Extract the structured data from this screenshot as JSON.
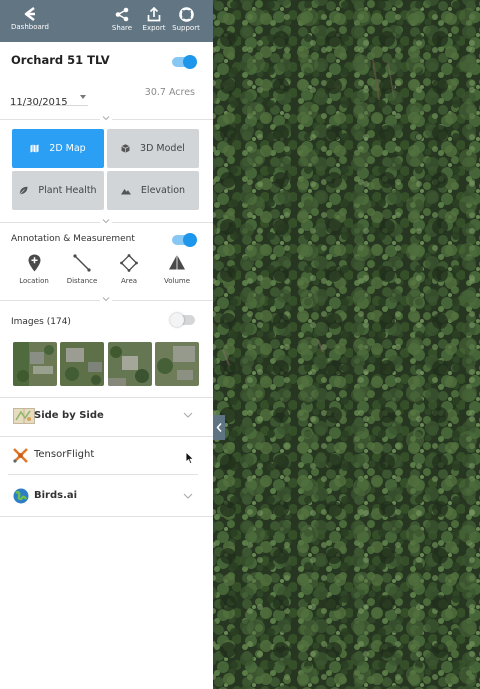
{
  "topbar": {
    "back_label": "Dashboard",
    "share_label": "Share",
    "export_label": "Export",
    "support_label": "Support"
  },
  "map_info": {
    "title": "Orchard 51 TLV",
    "toggle_on": true,
    "date": "11/30/2015",
    "area": "30.7 Acres"
  },
  "views": [
    {
      "label": "2D Map",
      "icon": "map-icon",
      "active": true
    },
    {
      "label": "3D Model",
      "icon": "cube-icon",
      "active": false
    },
    {
      "label": "Plant Health",
      "icon": "leaf-icon",
      "active": false
    },
    {
      "label": "Elevation",
      "icon": "mountain-icon",
      "active": false
    }
  ],
  "annotation": {
    "label": "Annotation & Measurement",
    "toggle_on": true,
    "tools": [
      {
        "label": "Location",
        "icon": "location-pin-icon"
      },
      {
        "label": "Distance",
        "icon": "distance-line-icon"
      },
      {
        "label": "Area",
        "icon": "area-polygon-icon"
      },
      {
        "label": "Volume",
        "icon": "volume-pyramid-icon"
      }
    ]
  },
  "images": {
    "label": "Images (174)",
    "toggle_on": false,
    "thumbnail_count_visible": 4
  },
  "plugins": [
    {
      "name": "Side by Side",
      "bold": true,
      "icon": "side-by-side-map-icon"
    },
    {
      "name": "TensorFlight",
      "bold": false,
      "icon": "tensorflight-logo-icon"
    },
    {
      "name": "Birds.ai",
      "bold": true,
      "icon": "birds-ai-globe-icon"
    }
  ],
  "colors": {
    "topbar": "#617583",
    "accent": "#2b9ff3",
    "button_inactive": "#d1d5d8",
    "canopy": "#2d3d27"
  }
}
